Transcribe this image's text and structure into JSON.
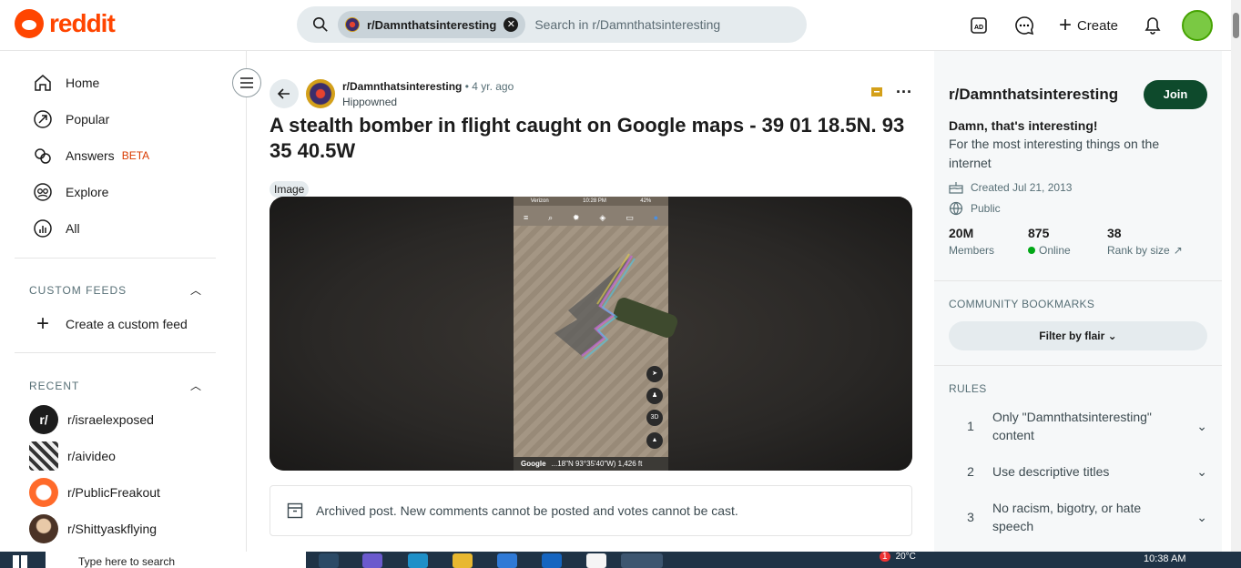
{
  "header": {
    "logo_text": "reddit",
    "search_chip": "r/Damnthatsinteresting",
    "search_placeholder": "Search in r/Damnthatsinteresting",
    "create_label": "Create"
  },
  "sidebar": {
    "nav": [
      {
        "label": "Home",
        "icon": "home-icon"
      },
      {
        "label": "Popular",
        "icon": "popular-icon"
      },
      {
        "label": "Answers",
        "badge": "BETA",
        "icon": "answers-icon"
      },
      {
        "label": "Explore",
        "icon": "explore-icon"
      },
      {
        "label": "All",
        "icon": "all-icon"
      }
    ],
    "custom_feeds_header": "CUSTOM FEEDS",
    "create_feed_label": "Create a custom feed",
    "recent_header": "RECENT",
    "recent": [
      {
        "label": "r/israelexposed",
        "color": "#1c1c1c"
      },
      {
        "label": "r/aivideo",
        "color": "#5b5b5b"
      },
      {
        "label": "r/PublicFreakout",
        "color": "#ff6a2a"
      },
      {
        "label": "r/Shittyaskflying",
        "color": "#6b4b3b"
      }
    ]
  },
  "post": {
    "subreddit": "r/Damnthatsinteresting",
    "time": "• 4 yr. ago",
    "author": "Hippowned",
    "title": "A stealth bomber in flight caught on Google maps - 39 01 18.5N. 93 35 40.5W",
    "flair": "Image",
    "image": {
      "status_left": "Verizon",
      "status_time": "10:28 PM",
      "status_right": "42%",
      "map_buttons": [
        "",
        "",
        "3D",
        ""
      ],
      "footer_brand": "Google",
      "footer_coords": "...18\"N 93°35'40\"W) 1,426 ft"
    },
    "archived_notice": "Archived post. New comments cannot be posted and votes cannot be cast."
  },
  "community": {
    "name": "r/Damnthatsinteresting",
    "join_label": "Join",
    "tagline": "Damn, that's interesting!",
    "description": "For the most interesting things on the internet",
    "created": "Created Jul 21, 2013",
    "visibility": "Public",
    "stats": [
      {
        "value": "20M",
        "label": "Members"
      },
      {
        "value": "875",
        "label": "Online"
      },
      {
        "value": "38",
        "label": "Rank by size"
      }
    ],
    "bookmarks_header": "COMMUNITY BOOKMARKS",
    "filter_label": "Filter by flair",
    "rules_header": "RULES",
    "rules": [
      {
        "n": "1",
        "text": "Only \"Damnthatsinteresting\" content"
      },
      {
        "n": "2",
        "text": "Use descriptive titles"
      },
      {
        "n": "3",
        "text": "No racism, bigotry, or hate speech"
      }
    ]
  },
  "taskbar": {
    "search_placeholder": "Type here to search",
    "notification_count": "1",
    "temperature": "20°C",
    "clock": "10:38 AM"
  },
  "colors": {
    "brand": "#ff4500",
    "join": "#0e4a2c",
    "beta": "#d93a00",
    "online": "#01a816"
  }
}
